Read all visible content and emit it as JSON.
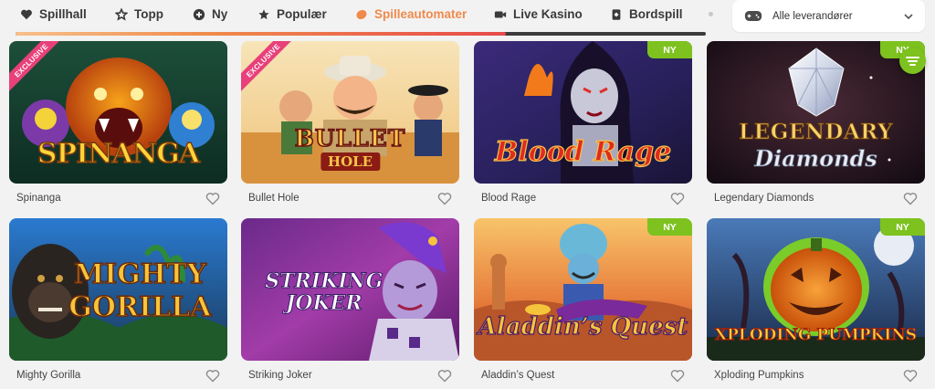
{
  "nav": {
    "items": [
      {
        "label": "Spillhall",
        "icon": "heart-icon"
      },
      {
        "label": "Topp",
        "icon": "star-outline-icon"
      },
      {
        "label": "Ny",
        "icon": "plus-circle-icon"
      },
      {
        "label": "Populær",
        "icon": "star-icon"
      },
      {
        "label": "Spilleautomater",
        "icon": "slot-icon",
        "active": true
      },
      {
        "label": "Live Kasino",
        "icon": "video-camera-icon"
      },
      {
        "label": "Bordspill",
        "icon": "card-icon"
      }
    ],
    "scroll_progress": 0.71,
    "colors": {
      "active": "#f08a4b",
      "text": "#3a3a3a"
    }
  },
  "provider_select": {
    "label": "Alle leverandører",
    "icon": "gamepad-icon"
  },
  "badges": {
    "new": "NY",
    "exclusive": "EXCLUSIVE"
  },
  "games": [
    {
      "name": "Spinanga",
      "art_title": "SPINANGA",
      "exclusive": true,
      "new": false
    },
    {
      "name": "Bullet Hole",
      "art_title": "BULLET",
      "art_subtitle": "HOLE",
      "exclusive": true,
      "new": false
    },
    {
      "name": "Blood Rage",
      "art_title": "Blood Rage",
      "exclusive": false,
      "new": true
    },
    {
      "name": "Legendary Diamonds",
      "art_title": "LEGENDARY",
      "art_subtitle": "Diamonds",
      "exclusive": false,
      "new": true
    },
    {
      "name": "Mighty Gorilla",
      "art_title": "MIGHTY",
      "art_subtitle": "GORILLA",
      "exclusive": false,
      "new": false
    },
    {
      "name": "Striking Joker",
      "art_title": "STRIKING",
      "art_subtitle": "JOKER",
      "exclusive": false,
      "new": false
    },
    {
      "name": "Aladdin’s Quest",
      "art_title": "Aladdin’s Quest",
      "exclusive": false,
      "new": true
    },
    {
      "name": "Xploding Pumpkins",
      "art_title": "XPLODING PUMPKINS",
      "exclusive": false,
      "new": true
    }
  ],
  "colors": {
    "badge_new": "#7dc21e",
    "ribbon": "#e8407a",
    "background": "#f2f2f2"
  }
}
